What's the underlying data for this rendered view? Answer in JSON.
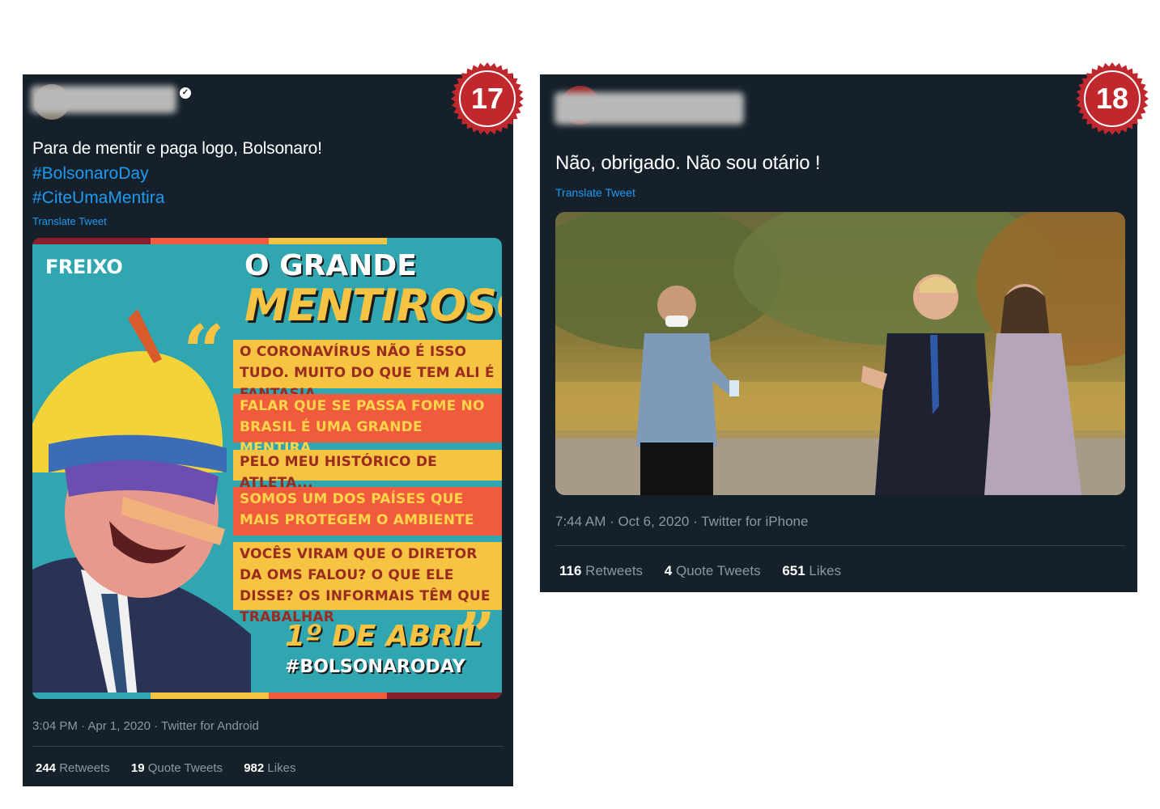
{
  "tweets": [
    {
      "badge": "17",
      "text": "Para de mentir e paga logo, Bolsonaro!",
      "hashtags": [
        "#BolsonaroDay",
        "#CiteUmaMentira"
      ],
      "translate": "Translate Tweet",
      "poster": {
        "brand": "FREIXO",
        "headline_top": "O GRANDE",
        "headline_main": "MENTIROSO",
        "quotes": [
          "O CORONAVÍRUS NÃO É ISSO TUDO. MUITO DO QUE TEM ALI É FANTASIA",
          "FALAR QUE SE PASSA FOME NO BRASIL É UMA GRANDE MENTIRA",
          "PELO MEU HISTÓRICO DE ATLETA...",
          "SOMOS UM DOS PAÍSES QUE MAIS PROTEGEM O AMBIENTE",
          "VOCÊS VIRAM QUE O DIRETOR DA OMS FALOU? O QUE ELE DISSE? OS INFORMAIS TÊM QUE TRABALHAR"
        ],
        "date": "1º DE ABRIL",
        "hashtag": "#BOLSONARODAY"
      },
      "meta": "3:04 PM · Apr 1, 2020 · Twitter for Android",
      "stats": {
        "retweets_count": "244",
        "retweets_label": "Retweets",
        "quotes_count": "19",
        "quotes_label": "Quote Tweets",
        "likes_count": "982",
        "likes_label": "Likes"
      }
    },
    {
      "badge": "18",
      "text": "Não, obrigado. Não sou otário !",
      "translate": "Translate Tweet",
      "meta": "7:44 AM · Oct 6, 2020 · Twitter for iPhone",
      "stats": {
        "retweets_count": "116",
        "retweets_label": "Retweets",
        "quotes_count": "4",
        "quotes_label": "Quote Tweets",
        "likes_count": "651",
        "likes_label": "Likes"
      }
    }
  ],
  "colors": {
    "tweet_bg": "#15202b",
    "link": "#1d9bf0",
    "badge": "#c0282d",
    "poster_teal": "#2fa6b0",
    "poster_yellow": "#f6c343",
    "poster_red": "#ef5b3c"
  }
}
